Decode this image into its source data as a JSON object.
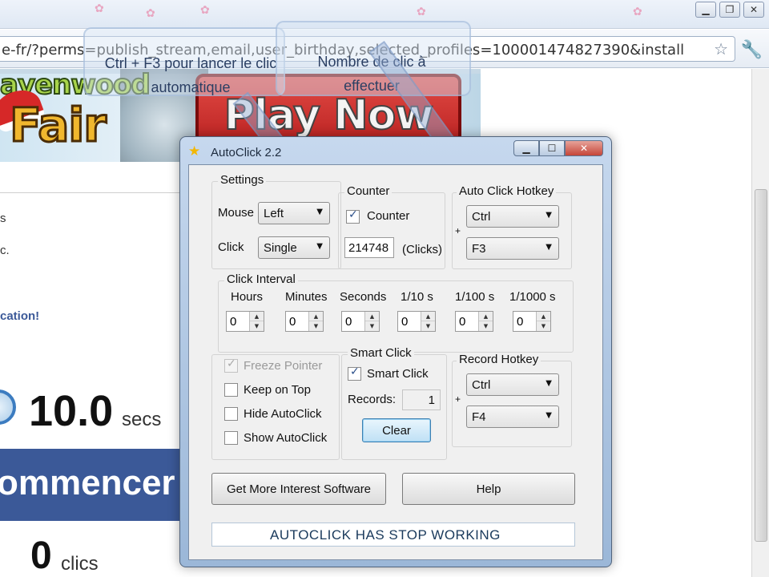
{
  "browser": {
    "url": "e-fr/?perms=publish_stream,email,user_birthday,selected_profiles=100001474827390&install",
    "window_controls": [
      "minimize",
      "restore",
      "close"
    ]
  },
  "page": {
    "logo_line1": "avenwood",
    "logo_line2": "Fair",
    "play_now": "Play Now",
    "frag1": "s",
    "frag2": "c.",
    "link": "cation!",
    "timer_value": "10.0",
    "timer_unit": "secs",
    "start_label": "ommencer",
    "clics_value": "0",
    "clics_unit": "clics"
  },
  "annotations": {
    "note1_line1": "Ctrl + F3 pour lancer le clic",
    "note1_line2": "automatique",
    "note2_line1": "Nombre de clic à",
    "note2_line2": "effectuer"
  },
  "autoclick": {
    "title": "AutoClick 2.2",
    "settings": {
      "legend": "Settings",
      "mouse_label": "Mouse",
      "mouse_value": "Left",
      "click_label": "Click",
      "click_value": "Single"
    },
    "counter": {
      "legend": "Counter",
      "checkbox_label": "Counter",
      "checked": true,
      "value": "214748",
      "unit": "(Clicks)"
    },
    "hotkey": {
      "legend": "Auto Click Hotkey",
      "modifier": "Ctrl",
      "plus": "+",
      "key": "F3"
    },
    "interval": {
      "legend": "Click Interval",
      "fields": [
        {
          "label": "Hours",
          "value": "0"
        },
        {
          "label": "Minutes",
          "value": "0"
        },
        {
          "label": "Seconds",
          "value": "0"
        },
        {
          "label": "1/10 s",
          "value": "0"
        },
        {
          "label": "1/100 s",
          "value": "0"
        },
        {
          "label": "1/1000 s",
          "value": "0"
        }
      ]
    },
    "options": {
      "freeze_pointer": "Freeze Pointer",
      "keep_on_top": "Keep on Top",
      "hide_autoclick": "Hide AutoClick",
      "show_autoclick": "Show AutoClick"
    },
    "smart_click": {
      "legend": "Smart Click",
      "checkbox_label": "Smart Click",
      "checked": true,
      "records_label": "Records:",
      "records_value": "1",
      "clear_label": "Clear"
    },
    "record_hotkey": {
      "legend": "Record Hotkey",
      "modifier": "Ctrl",
      "plus": "+",
      "key": "F4"
    },
    "buttons": {
      "more_software": "Get More Interest Software",
      "help": "Help"
    },
    "status": "AUTOCLICK HAS STOP WORKING"
  }
}
